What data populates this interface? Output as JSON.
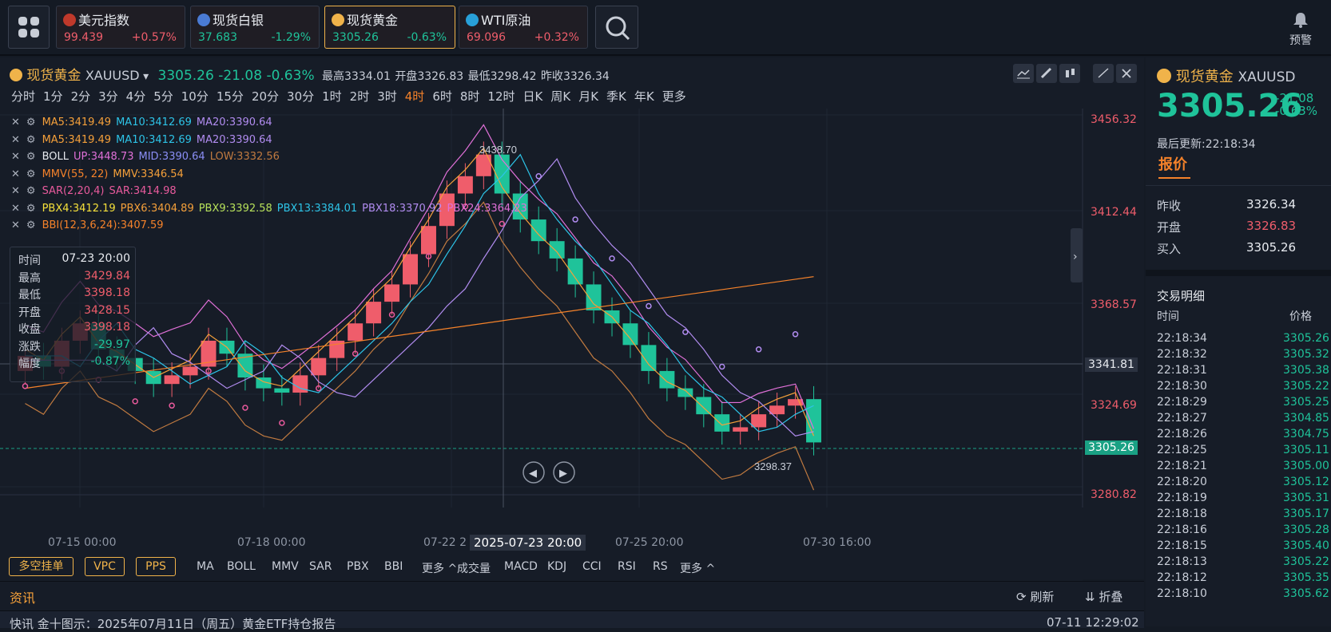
{
  "quotes": [
    {
      "name": "美元指数",
      "price": "99.439",
      "change": "+0.57%",
      "dir": "up",
      "icon": "us-flag-icon",
      "icon_color": "#c0392b"
    },
    {
      "name": "现货白银",
      "price": "37.683",
      "change": "-1.29%",
      "dir": "down",
      "icon": "silver-icon",
      "icon_color": "#4a7bd4"
    },
    {
      "name": "现货黄金",
      "price": "3305.26",
      "change": "-0.63%",
      "dir": "down",
      "icon": "gold-icon",
      "icon_color": "#f0b34a"
    },
    {
      "name": "WTI原油",
      "price": "69.096",
      "change": "+0.32%",
      "dir": "up",
      "icon": "oil-icon",
      "icon_color": "#28a0d8"
    }
  ],
  "alert_label": "预警",
  "header": {
    "name": "现货黄金",
    "symbol": "XAUUSD",
    "price": "3305.26",
    "change": "-21.08",
    "pct": "-0.63%",
    "high_label": "最高",
    "high": "3334.01",
    "open_label": "开盘",
    "open": "3326.83",
    "low_label": "最低",
    "low": "3298.42",
    "prev_label": "昨收",
    "prev": "3326.34"
  },
  "periods": [
    "分时",
    "1分",
    "2分",
    "3分",
    "4分",
    "5分",
    "10分",
    "15分",
    "20分",
    "30分",
    "1时",
    "2时",
    "3时",
    "4时",
    "6时",
    "8时",
    "12时",
    "日K",
    "周K",
    "月K",
    "季K",
    "年K",
    "更多"
  ],
  "active_period": "4时",
  "indicators": [
    [
      {
        "t": "MA5:3419.49",
        "c": "#f5a03a"
      },
      {
        "t": "MA10:3412.69",
        "c": "#2dc4e8"
      },
      {
        "t": "MA20:3390.64",
        "c": "#b18cf0"
      }
    ],
    [
      {
        "t": "MA5:3419.49",
        "c": "#f5a03a"
      },
      {
        "t": "MA10:3412.69",
        "c": "#2dc4e8"
      },
      {
        "t": "MA20:3390.64",
        "c": "#b18cf0"
      }
    ],
    [
      {
        "t": "BOLL",
        "c": "#e6e9ee"
      },
      {
        "t": "UP:3448.73",
        "c": "#e070d8"
      },
      {
        "t": "MID:3390.64",
        "c": "#8a8ef5"
      },
      {
        "t": "LOW:3332.56",
        "c": "#c07a40"
      }
    ],
    [
      {
        "t": "MMV(55, 22)",
        "c": "#f5822a"
      },
      {
        "t": "MMV:3346.54",
        "c": "#f5a03a"
      }
    ],
    [
      {
        "t": "SAR(2,20,4)",
        "c": "#e85a9c"
      },
      {
        "t": "SAR:3414.98",
        "c": "#e85a9c"
      }
    ],
    [
      {
        "t": "PBX4:3412.19",
        "c": "#f5e03a"
      },
      {
        "t": "PBX6:3404.89",
        "c": "#f5a03a"
      },
      {
        "t": "PBX9:3392.58",
        "c": "#b6e05a"
      },
      {
        "t": "PBX13:3384.01",
        "c": "#2dc4e8"
      },
      {
        "t": "PBX18:3370.92",
        "c": "#b18cf0"
      },
      {
        "t": "PBX24:3364.23",
        "c": "#e070d8"
      }
    ],
    [
      {
        "t": "BBI(12,3,6,24):3407.59",
        "c": "#f5822a"
      }
    ]
  ],
  "tooltip": [
    {
      "k": "时间",
      "v": "07-23 20:00",
      "c": "#e8ebf0"
    },
    {
      "k": "最高",
      "v": "3429.84",
      "c": "#ef5d6b"
    },
    {
      "k": "最低",
      "v": "3398.18",
      "c": "#ef5d6b"
    },
    {
      "k": "开盘",
      "v": "3428.15",
      "c": "#ef5d6b"
    },
    {
      "k": "收盘",
      "v": "3398.18",
      "c": "#ef5d6b"
    },
    {
      "k": "涨跌",
      "v": "-29.97",
      "c": "#1fc39a"
    },
    {
      "k": "幅度",
      "v": "-0.87%",
      "c": "#1fc39a"
    }
  ],
  "y_axis": [
    "3456.32",
    "3412.44",
    "3368.57",
    "3341.81",
    "3324.69",
    "3305.26",
    "3280.82"
  ],
  "x_axis": [
    "07-15 00:00",
    "07-18 00:00",
    "07-22 2",
    "2025-07-23 20:00",
    "07-25 20:00",
    "07-30 16:00"
  ],
  "peak_label": "3438.70",
  "trough_label": "3298.37",
  "bottom": {
    "pills": [
      "多空挂单",
      "VPC",
      "PPS"
    ],
    "main_ind": [
      "MA",
      "BOLL",
      "MMV",
      "SAR",
      "PBX",
      "BBI",
      "更多 ^"
    ],
    "sub_ind": [
      "成交量",
      "MACD",
      "KDJ",
      "CCI",
      "RSI",
      "RS",
      "更多 ^"
    ]
  },
  "news": {
    "title": "资讯",
    "refresh": "刷新",
    "fold": "折叠",
    "item": "快讯 金十图示：2025年07月11日（周五）黄金ETF持仓报告",
    "time": "07-11 12:29:02"
  },
  "side": {
    "name": "现货黄金",
    "symbol": "XAUUSD",
    "price": "3305.26",
    "change": "-21.08",
    "pct": "-0.63%",
    "updated": "最后更新:22:18:34",
    "tab": "报价",
    "rows": [
      {
        "k": "昨收",
        "v": "3326.34",
        "c": "#e8ebf0"
      },
      {
        "k": "开盘",
        "v": "3326.83",
        "c": "#ef5d6b"
      },
      {
        "k": "买入",
        "v": "3305.26",
        "c": "#e8ebf0"
      }
    ],
    "trade_title": "交易明细",
    "col_time": "时间",
    "col_price": "价格"
  },
  "trades": [
    [
      "22:18:34",
      "3305.26"
    ],
    [
      "22:18:32",
      "3305.32"
    ],
    [
      "22:18:31",
      "3305.38"
    ],
    [
      "22:18:30",
      "3305.22"
    ],
    [
      "22:18:29",
      "3305.25"
    ],
    [
      "22:18:27",
      "3304.85"
    ],
    [
      "22:18:26",
      "3304.75"
    ],
    [
      "22:18:25",
      "3305.11"
    ],
    [
      "22:18:21",
      "3305.00"
    ],
    [
      "22:18:20",
      "3305.12"
    ],
    [
      "22:18:19",
      "3305.31"
    ],
    [
      "22:18:18",
      "3305.17"
    ],
    [
      "22:18:16",
      "3305.28"
    ],
    [
      "22:18:15",
      "3305.40"
    ],
    [
      "22:18:13",
      "3305.22"
    ],
    [
      "22:18:12",
      "3305.35"
    ],
    [
      "22:18:10",
      "3305.62"
    ]
  ]
}
